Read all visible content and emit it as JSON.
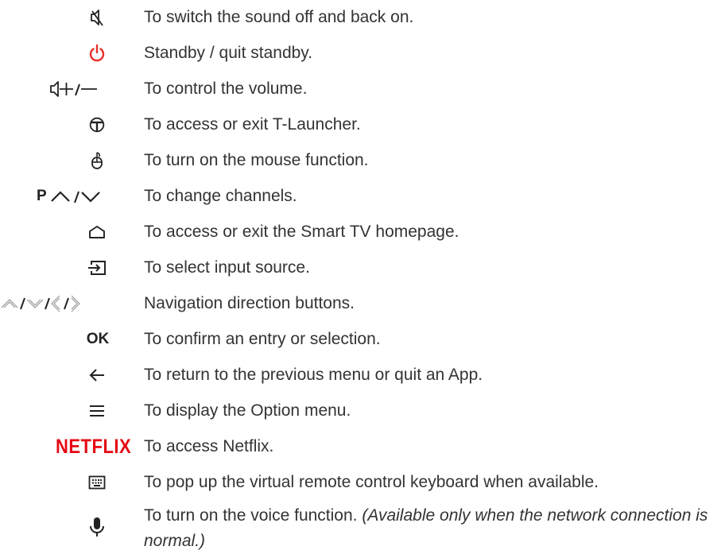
{
  "items": [
    {
      "icon": "mute-icon",
      "text": "To switch the sound off and back on."
    },
    {
      "icon": "power-icon",
      "text": "Standby / quit standby.",
      "color": "#e8312a"
    },
    {
      "icon": "volume-plus-minus-icon",
      "text": "To control the volume."
    },
    {
      "icon": "t-launcher-icon",
      "text": "To access or exit T-Launcher."
    },
    {
      "icon": "mouse-icon",
      "text": "To turn on the mouse function."
    },
    {
      "icon": "channel-up-down-icon",
      "label": "P",
      "text": "To change channels."
    },
    {
      "icon": "home-icon",
      "text": "To access or exit the Smart TV homepage."
    },
    {
      "icon": "input-source-icon",
      "text": "To select input source."
    },
    {
      "icon": "navigation-arrows-icon",
      "text": "Navigation direction buttons."
    },
    {
      "icon": "ok-label",
      "label": "OK",
      "text": "To confirm an entry or selection."
    },
    {
      "icon": "back-arrow-icon",
      "text": "To return to the previous menu or quit an App."
    },
    {
      "icon": "option-menu-icon",
      "text": "To display the Option menu."
    },
    {
      "icon": "netflix-logo",
      "label": "NETFLIX",
      "text": "To access Netflix.",
      "color": "#e50914"
    },
    {
      "icon": "keyboard-icon",
      "text": "To pop up the virtual remote control keyboard when available."
    },
    {
      "icon": "microphone-icon",
      "text": "To turn on the voice function.",
      "note": "(Available only when the network connection is normal.)"
    }
  ]
}
